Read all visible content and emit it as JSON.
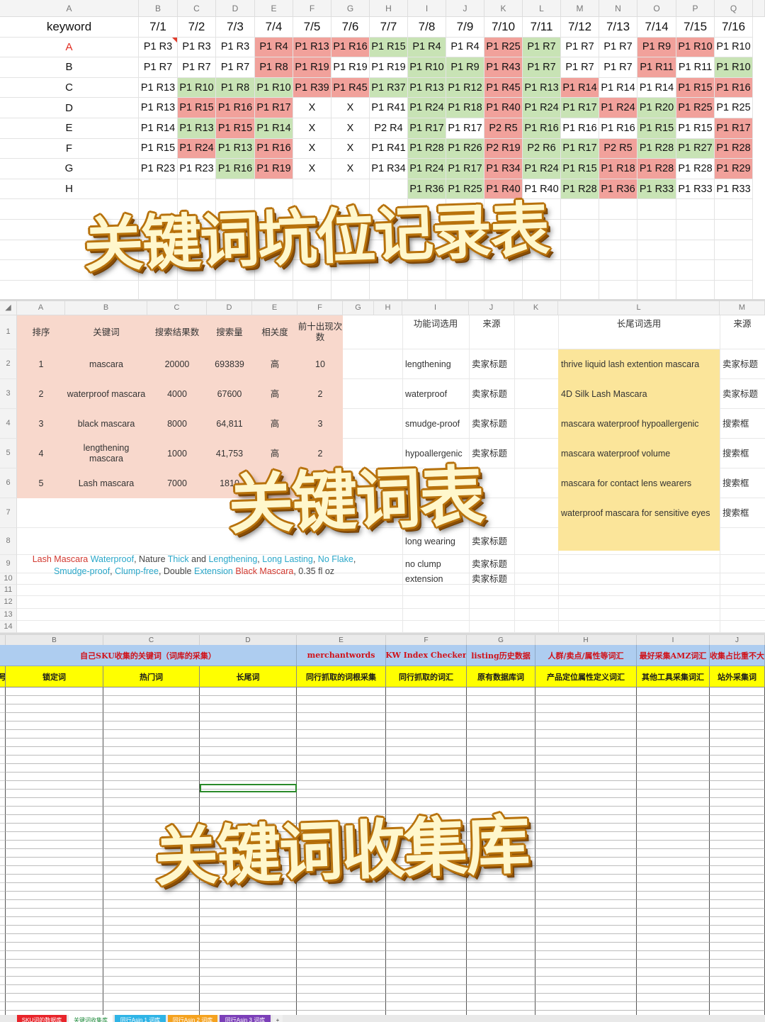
{
  "ranking_sheet": {
    "col_letters": [
      "A",
      "B",
      "C",
      "D",
      "E",
      "F",
      "G",
      "H",
      "I",
      "J",
      "K",
      "L",
      "M",
      "N",
      "O",
      "P",
      "Q"
    ],
    "keyword_header": "keyword",
    "dates": [
      "7/1",
      "7/2",
      "7/3",
      "7/4",
      "7/5",
      "7/6",
      "7/7",
      "7/8",
      "7/9",
      "7/10",
      "7/11",
      "7/12",
      "7/13",
      "7/14",
      "7/15",
      "7/16"
    ],
    "keywords": [
      "A",
      "B",
      "C",
      "D",
      "E",
      "F",
      "G",
      "H"
    ],
    "rows": [
      [
        [
          "P1 R3",
          "w"
        ],
        [
          "P1 R3",
          "w"
        ],
        [
          "P1 R3",
          "w"
        ],
        [
          "P1 R4",
          "r"
        ],
        [
          "P1 R13",
          "r"
        ],
        [
          "P1 R16",
          "r"
        ],
        [
          "P1 R15",
          "g"
        ],
        [
          "P1 R4",
          "g"
        ],
        [
          "P1 R4",
          "w"
        ],
        [
          "P1 R25",
          "r"
        ],
        [
          "P1 R7",
          "g"
        ],
        [
          "P1 R7",
          "w"
        ],
        [
          "P1 R7",
          "w"
        ],
        [
          "P1 R9",
          "r"
        ],
        [
          "P1 R10",
          "r"
        ],
        [
          "P1 R10",
          "w"
        ]
      ],
      [
        [
          "P1 R7",
          "w"
        ],
        [
          "P1 R7",
          "w"
        ],
        [
          "P1 R7",
          "w"
        ],
        [
          "P1 R8",
          "r"
        ],
        [
          "P1 R19",
          "r"
        ],
        [
          "P1 R19",
          "w"
        ],
        [
          "P1 R19",
          "w"
        ],
        [
          "P1 R10",
          "g"
        ],
        [
          "P1 R9",
          "g"
        ],
        [
          "P1 R43",
          "r"
        ],
        [
          "P1 R7",
          "g"
        ],
        [
          "P1 R7",
          "w"
        ],
        [
          "P1 R7",
          "w"
        ],
        [
          "P1 R11",
          "r"
        ],
        [
          "P1 R11",
          "w"
        ],
        [
          "P1 R10",
          "g"
        ]
      ],
      [
        [
          "P1 R13",
          "w"
        ],
        [
          "P1 R10",
          "g"
        ],
        [
          "P1 R8",
          "g"
        ],
        [
          "P1 R10",
          "g"
        ],
        [
          "P1 R39",
          "r"
        ],
        [
          "P1 R45",
          "r"
        ],
        [
          "P1 R37",
          "g"
        ],
        [
          "P1 R13",
          "g"
        ],
        [
          "P1 R12",
          "g"
        ],
        [
          "P1 R45",
          "r"
        ],
        [
          "P1 R13",
          "g"
        ],
        [
          "P1 R14",
          "r"
        ],
        [
          "P1 R14",
          "w"
        ],
        [
          "P1 R14",
          "w"
        ],
        [
          "P1 R15",
          "r"
        ],
        [
          "P1 R16",
          "r"
        ]
      ],
      [
        [
          "P1 R13",
          "w"
        ],
        [
          "P1 R15",
          "r"
        ],
        [
          "P1 R16",
          "r"
        ],
        [
          "P1 R17",
          "r"
        ],
        [
          "X",
          "w"
        ],
        [
          "X",
          "w"
        ],
        [
          "P1 R41",
          "w"
        ],
        [
          "P1 R24",
          "g"
        ],
        [
          "P1 R18",
          "g"
        ],
        [
          "P1 R40",
          "r"
        ],
        [
          "P1 R24",
          "g"
        ],
        [
          "P1 R17",
          "g"
        ],
        [
          "P1 R24",
          "r"
        ],
        [
          "P1 R20",
          "g"
        ],
        [
          "P1 R25",
          "r"
        ],
        [
          "P1 R25",
          "w"
        ]
      ],
      [
        [
          "P1 R14",
          "w"
        ],
        [
          "P1 R13",
          "g"
        ],
        [
          "P1 R15",
          "r"
        ],
        [
          "P1 R14",
          "g"
        ],
        [
          "X",
          "w"
        ],
        [
          "X",
          "w"
        ],
        [
          "P2 R4",
          "w"
        ],
        [
          "P1 R17",
          "g"
        ],
        [
          "P1 R17",
          "w"
        ],
        [
          "P2 R5",
          "r"
        ],
        [
          "P1 R16",
          "g"
        ],
        [
          "P1 R16",
          "w"
        ],
        [
          "P1 R16",
          "w"
        ],
        [
          "P1 R15",
          "g"
        ],
        [
          "P1 R15",
          "w"
        ],
        [
          "P1 R17",
          "r"
        ]
      ],
      [
        [
          "P1 R15",
          "w"
        ],
        [
          "P1 R24",
          "r"
        ],
        [
          "P1 R13",
          "g"
        ],
        [
          "P1 R16",
          "r"
        ],
        [
          "X",
          "w"
        ],
        [
          "X",
          "w"
        ],
        [
          "P1 R41",
          "w"
        ],
        [
          "P1 R28",
          "g"
        ],
        [
          "P1 R26",
          "g"
        ],
        [
          "P2 R19",
          "r"
        ],
        [
          "P2 R6",
          "g"
        ],
        [
          "P1 R17",
          "g"
        ],
        [
          "P2 R5",
          "r"
        ],
        [
          "P1 R28",
          "g"
        ],
        [
          "P1 R27",
          "g"
        ],
        [
          "P1 R28",
          "r"
        ]
      ],
      [
        [
          "P1 R23",
          "w"
        ],
        [
          "P1 R23",
          "w"
        ],
        [
          "P1 R16",
          "g"
        ],
        [
          "P1 R19",
          "r"
        ],
        [
          "X",
          "w"
        ],
        [
          "X",
          "w"
        ],
        [
          "P1 R34",
          "w"
        ],
        [
          "P1 R24",
          "g"
        ],
        [
          "P1 R17",
          "g"
        ],
        [
          "P1 R34",
          "r"
        ],
        [
          "P1 R24",
          "g"
        ],
        [
          "P1 R15",
          "g"
        ],
        [
          "P1 R18",
          "r"
        ],
        [
          "P1 R28",
          "r"
        ],
        [
          "P1 R28",
          "w"
        ],
        [
          "P1 R29",
          "r"
        ]
      ],
      [
        [
          "",
          "w"
        ],
        [
          "",
          "w"
        ],
        [
          "",
          "w"
        ],
        [
          "",
          "w"
        ],
        [
          "",
          "w"
        ],
        [
          "",
          "w"
        ],
        [
          "",
          "w"
        ],
        [
          "P1 R36",
          "g"
        ],
        [
          "P1 R25",
          "g"
        ],
        [
          "P1 R40",
          "r"
        ],
        [
          "P1 R40",
          "w"
        ],
        [
          "P1 R28",
          "g"
        ],
        [
          "P1 R36",
          "r"
        ],
        [
          "P1 R33",
          "g"
        ],
        [
          "P1 R33",
          "w"
        ],
        [
          "P1 R33",
          "w"
        ]
      ]
    ]
  },
  "overlay_titles": {
    "t1": "关键词坑位记录表",
    "t2": "关键词表",
    "t3": "关键词收集库"
  },
  "keyword_sheet": {
    "col_letters": [
      "A",
      "B",
      "C",
      "D",
      "E",
      "F",
      "G",
      "H",
      "I",
      "J",
      "K",
      "L",
      "M"
    ],
    "row_numbers": [
      "1",
      "2",
      "3",
      "4",
      "5",
      "6",
      "7",
      "8",
      "9",
      "10",
      "11",
      "12",
      "13",
      "14"
    ],
    "headers": {
      "rank": "排序",
      "keyword": "关键词",
      "results": "搜索结果数",
      "volume": "搜索量",
      "relevance": "相关度",
      "top10": "前十出现次数",
      "func_kw": "功能词选用",
      "func_src": "来源",
      "long_tail": "长尾词选用",
      "long_src": "来源"
    },
    "main_rows": [
      {
        "rank": "1",
        "keyword": "mascara",
        "results": "20000",
        "volume": "693839",
        "relevance": "高",
        "top10": "10"
      },
      {
        "rank": "2",
        "keyword": "waterproof mascara",
        "results": "4000",
        "volume": "67600",
        "relevance": "高",
        "top10": "2"
      },
      {
        "rank": "3",
        "keyword": "black mascara",
        "results": "8000",
        "volume": "64,811",
        "relevance": "高",
        "top10": "3"
      },
      {
        "rank": "4",
        "keyword": "lengthening mascara",
        "results": "1000",
        "volume": "41,753",
        "relevance": "高",
        "top10": "2"
      },
      {
        "rank": "5",
        "keyword": "Lash mascara",
        "results": "7000",
        "volume": "1810",
        "relevance": "高",
        "top10": "1"
      }
    ],
    "functional": [
      {
        "word": "lengthening",
        "src": "卖家标题"
      },
      {
        "word": "waterproof",
        "src": "卖家标题"
      },
      {
        "word": "smudge-proof",
        "src": "卖家标题"
      },
      {
        "word": "hypoallergenic",
        "src": "卖家标题"
      },
      {
        "word": "",
        "src": ""
      },
      {
        "word": "",
        "src": ""
      },
      {
        "word": "long wearing",
        "src": "卖家标题"
      },
      {
        "word": "no clump",
        "src": "卖家标题"
      },
      {
        "word": "extension",
        "src": "卖家标题"
      }
    ],
    "long_tail": [
      {
        "word": "thrive liquid lash extention mascara",
        "src": "卖家标题"
      },
      {
        "word": "4D Silk Lash Mascara",
        "src": "卖家标题"
      },
      {
        "word": "mascara waterproof hypoallergenic",
        "src": "搜索框"
      },
      {
        "word": "mascara waterproof volume",
        "src": "搜索框"
      },
      {
        "word": "mascara for contact lens wearers",
        "src": "搜索框"
      },
      {
        "word": "waterproof mascara for sensitive eyes",
        "src": "搜索框"
      }
    ],
    "title_parts": [
      {
        "t": "Lash ",
        "c": "#d2382f"
      },
      {
        "t": "Mascara ",
        "c": "#d2382f"
      },
      {
        "t": "Waterproof",
        "c": "#2aa7c9"
      },
      {
        "t": ", Nature ",
        "c": "#444"
      },
      {
        "t": "Thick",
        "c": "#2aa7c9"
      },
      {
        "t": " and ",
        "c": "#444"
      },
      {
        "t": "Lengthening",
        "c": "#2aa7c9"
      },
      {
        "t": ", ",
        "c": "#444"
      },
      {
        "t": "Long Lasting",
        "c": "#2aa7c9"
      },
      {
        "t": ", ",
        "c": "#444"
      },
      {
        "t": "No Flake",
        "c": "#2aa7c9"
      },
      {
        "t": ", ",
        "c": "#444"
      },
      {
        "t": "Smudge-proof",
        "c": "#2aa7c9"
      },
      {
        "t": ", ",
        "c": "#444"
      },
      {
        "t": "Clump-free",
        "c": "#2aa7c9"
      },
      {
        "t": ", Double ",
        "c": "#444"
      },
      {
        "t": "Extension",
        "c": "#2aa7c9"
      },
      {
        "t": " ",
        "c": "#444"
      },
      {
        "t": "Black ",
        "c": "#d2382f"
      },
      {
        "t": "Mascara",
        "c": "#d2382f"
      },
      {
        "t": ", 0.35 fl oz",
        "c": "#444"
      }
    ]
  },
  "collection_sheet": {
    "col_letters": [
      "B",
      "C",
      "D",
      "E",
      "F",
      "G",
      "H",
      "I",
      "J"
    ],
    "row1": [
      "自己SKU收集的关键词（词库的采集）",
      "merchantwords",
      "KW Index Checker",
      "listing历史数据",
      "人群/卖点/属性等词汇",
      "最好采集AMZ词汇",
      "收集占比重不大"
    ],
    "row2": [
      "号",
      "锁定词",
      "热门词",
      "长尾词",
      "同行抓取的词根采集",
      "同行抓取的词汇",
      "原有数据库词",
      "产品定位属性定义词汇",
      "其他工具采集词汇",
      "站外采集词"
    ],
    "sheet_tabs": [
      {
        "label": "SKU词的数据库",
        "bg": "#e8242a",
        "fg": "#ffffff"
      },
      {
        "label": "关键词收集库",
        "bg": "#ffffff",
        "fg": "#1d8a3a"
      },
      {
        "label": "同行Asin 1 词库",
        "bg": "#2fb4e6",
        "fg": "#ffffff"
      },
      {
        "label": "同行Asin 2 词库",
        "bg": "#f5a21f",
        "fg": "#ffffff"
      },
      {
        "label": "同行Asin 3 词库",
        "bg": "#7b3fb8",
        "fg": "#ffffff"
      },
      {
        "label": "+",
        "bg": "#f0f0f0",
        "fg": "#333333"
      }
    ]
  },
  "colors": {
    "red": "#f1a19b",
    "green": "#c8e3b5",
    "pink": "#f8d8cc",
    "yellow": "#fbe59a",
    "header_blue": "#aecdf0",
    "header_yellow": "#ffff00",
    "title_fill": "#fff7cc",
    "title_outline": "#b8720c"
  }
}
